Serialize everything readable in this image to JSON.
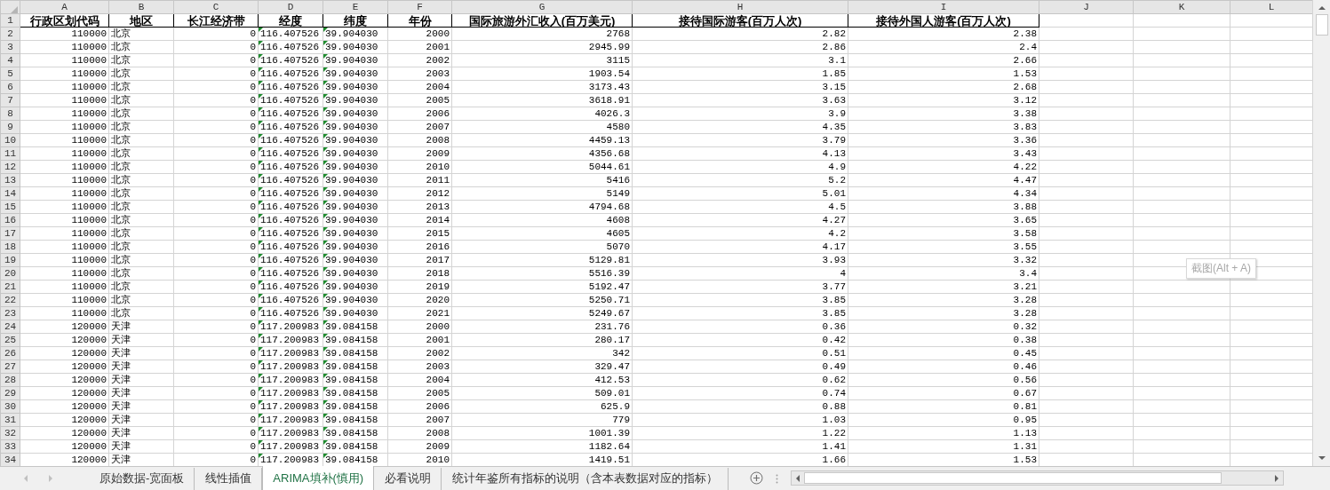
{
  "columns": [
    {
      "letter": "A",
      "header": "行政区划代码",
      "kind": "number"
    },
    {
      "letter": "B",
      "header": "地区",
      "kind": "text"
    },
    {
      "letter": "C",
      "header": "长江经济带",
      "kind": "number"
    },
    {
      "letter": "D",
      "header": "经度",
      "kind": "flagged_text"
    },
    {
      "letter": "E",
      "header": "纬度",
      "kind": "flagged_text"
    },
    {
      "letter": "F",
      "header": "年份",
      "kind": "number"
    },
    {
      "letter": "G",
      "header": "国际旅游外汇收入(百万美元)",
      "kind": "number"
    },
    {
      "letter": "H",
      "header": "接待国际游客(百万人次)",
      "kind": "number"
    },
    {
      "letter": "I",
      "header": "接待外国人游客(百万人次)",
      "kind": "number"
    },
    {
      "letter": "J"
    },
    {
      "letter": "K"
    },
    {
      "letter": "L"
    }
  ],
  "header_row": {
    "number": "1"
  },
  "rows": [
    {
      "number": "2",
      "cells": [
        "110000",
        "北京",
        "0",
        "116.407526",
        "39.904030",
        "2000",
        "2768",
        "2.82",
        "2.38"
      ]
    },
    {
      "number": "3",
      "cells": [
        "110000",
        "北京",
        "0",
        "116.407526",
        "39.904030",
        "2001",
        "2945.99",
        "2.86",
        "2.4"
      ]
    },
    {
      "number": "4",
      "cells": [
        "110000",
        "北京",
        "0",
        "116.407526",
        "39.904030",
        "2002",
        "3115",
        "3.1",
        "2.66"
      ]
    },
    {
      "number": "5",
      "cells": [
        "110000",
        "北京",
        "0",
        "116.407526",
        "39.904030",
        "2003",
        "1903.54",
        "1.85",
        "1.53"
      ]
    },
    {
      "number": "6",
      "cells": [
        "110000",
        "北京",
        "0",
        "116.407526",
        "39.904030",
        "2004",
        "3173.43",
        "3.15",
        "2.68"
      ]
    },
    {
      "number": "7",
      "cells": [
        "110000",
        "北京",
        "0",
        "116.407526",
        "39.904030",
        "2005",
        "3618.91",
        "3.63",
        "3.12"
      ]
    },
    {
      "number": "8",
      "cells": [
        "110000",
        "北京",
        "0",
        "116.407526",
        "39.904030",
        "2006",
        "4026.3",
        "3.9",
        "3.38"
      ]
    },
    {
      "number": "9",
      "cells": [
        "110000",
        "北京",
        "0",
        "116.407526",
        "39.904030",
        "2007",
        "4580",
        "4.35",
        "3.83"
      ]
    },
    {
      "number": "10",
      "cells": [
        "110000",
        "北京",
        "0",
        "116.407526",
        "39.904030",
        "2008",
        "4459.13",
        "3.79",
        "3.36"
      ]
    },
    {
      "number": "11",
      "cells": [
        "110000",
        "北京",
        "0",
        "116.407526",
        "39.904030",
        "2009",
        "4356.68",
        "4.13",
        "3.43"
      ]
    },
    {
      "number": "12",
      "cells": [
        "110000",
        "北京",
        "0",
        "116.407526",
        "39.904030",
        "2010",
        "5044.61",
        "4.9",
        "4.22"
      ]
    },
    {
      "number": "13",
      "cells": [
        "110000",
        "北京",
        "0",
        "116.407526",
        "39.904030",
        "2011",
        "5416",
        "5.2",
        "4.47"
      ]
    },
    {
      "number": "14",
      "cells": [
        "110000",
        "北京",
        "0",
        "116.407526",
        "39.904030",
        "2012",
        "5149",
        "5.01",
        "4.34"
      ]
    },
    {
      "number": "15",
      "cells": [
        "110000",
        "北京",
        "0",
        "116.407526",
        "39.904030",
        "2013",
        "4794.68",
        "4.5",
        "3.88"
      ]
    },
    {
      "number": "16",
      "cells": [
        "110000",
        "北京",
        "0",
        "116.407526",
        "39.904030",
        "2014",
        "4608",
        "4.27",
        "3.65"
      ]
    },
    {
      "number": "17",
      "cells": [
        "110000",
        "北京",
        "0",
        "116.407526",
        "39.904030",
        "2015",
        "4605",
        "4.2",
        "3.58"
      ]
    },
    {
      "number": "18",
      "cells": [
        "110000",
        "北京",
        "0",
        "116.407526",
        "39.904030",
        "2016",
        "5070",
        "4.17",
        "3.55"
      ]
    },
    {
      "number": "19",
      "cells": [
        "110000",
        "北京",
        "0",
        "116.407526",
        "39.904030",
        "2017",
        "5129.81",
        "3.93",
        "3.32"
      ]
    },
    {
      "number": "20",
      "cells": [
        "110000",
        "北京",
        "0",
        "116.407526",
        "39.904030",
        "2018",
        "5516.39",
        "4",
        "3.4"
      ]
    },
    {
      "number": "21",
      "cells": [
        "110000",
        "北京",
        "0",
        "116.407526",
        "39.904030",
        "2019",
        "5192.47",
        "3.77",
        "3.21"
      ]
    },
    {
      "number": "22",
      "cells": [
        "110000",
        "北京",
        "0",
        "116.407526",
        "39.904030",
        "2020",
        "5250.71",
        "3.85",
        "3.28"
      ]
    },
    {
      "number": "23",
      "cells": [
        "110000",
        "北京",
        "0",
        "116.407526",
        "39.904030",
        "2021",
        "5249.67",
        "3.85",
        "3.28"
      ]
    },
    {
      "number": "24",
      "cells": [
        "120000",
        "天津",
        "0",
        "117.200983",
        "39.084158",
        "2000",
        "231.76",
        "0.36",
        "0.32"
      ]
    },
    {
      "number": "25",
      "cells": [
        "120000",
        "天津",
        "0",
        "117.200983",
        "39.084158",
        "2001",
        "280.17",
        "0.42",
        "0.38"
      ]
    },
    {
      "number": "26",
      "cells": [
        "120000",
        "天津",
        "0",
        "117.200983",
        "39.084158",
        "2002",
        "342",
        "0.51",
        "0.45"
      ]
    },
    {
      "number": "27",
      "cells": [
        "120000",
        "天津",
        "0",
        "117.200983",
        "39.084158",
        "2003",
        "329.47",
        "0.49",
        "0.46"
      ]
    },
    {
      "number": "28",
      "cells": [
        "120000",
        "天津",
        "0",
        "117.200983",
        "39.084158",
        "2004",
        "412.53",
        "0.62",
        "0.56"
      ]
    },
    {
      "number": "29",
      "cells": [
        "120000",
        "天津",
        "0",
        "117.200983",
        "39.084158",
        "2005",
        "509.01",
        "0.74",
        "0.67"
      ]
    },
    {
      "number": "30",
      "cells": [
        "120000",
        "天津",
        "0",
        "117.200983",
        "39.084158",
        "2006",
        "625.9",
        "0.88",
        "0.81"
      ]
    },
    {
      "number": "31",
      "cells": [
        "120000",
        "天津",
        "0",
        "117.200983",
        "39.084158",
        "2007",
        "779",
        "1.03",
        "0.95"
      ]
    },
    {
      "number": "32",
      "cells": [
        "120000",
        "天津",
        "0",
        "117.200983",
        "39.084158",
        "2008",
        "1001.39",
        "1.22",
        "1.13"
      ]
    },
    {
      "number": "33",
      "cells": [
        "120000",
        "天津",
        "0",
        "117.200983",
        "39.084158",
        "2009",
        "1182.64",
        "1.41",
        "1.31"
      ]
    },
    {
      "number": "34",
      "cells": [
        "120000",
        "天津",
        "0",
        "117.200983",
        "39.084158",
        "2010",
        "1419.51",
        "1.66",
        "1.53"
      ]
    }
  ],
  "tooltip": {
    "text": "截图(Alt + A)"
  },
  "sheet_tabs": [
    {
      "label": "原始数据-宽面板",
      "selected": false
    },
    {
      "label": "线性插值",
      "selected": false
    },
    {
      "label": "ARIMA填补(慎用)",
      "selected": true
    },
    {
      "label": "必看说明",
      "selected": false
    },
    {
      "label": "统计年鉴所有指标的说明（含本表数据对应的指标）",
      "selected": false
    }
  ]
}
